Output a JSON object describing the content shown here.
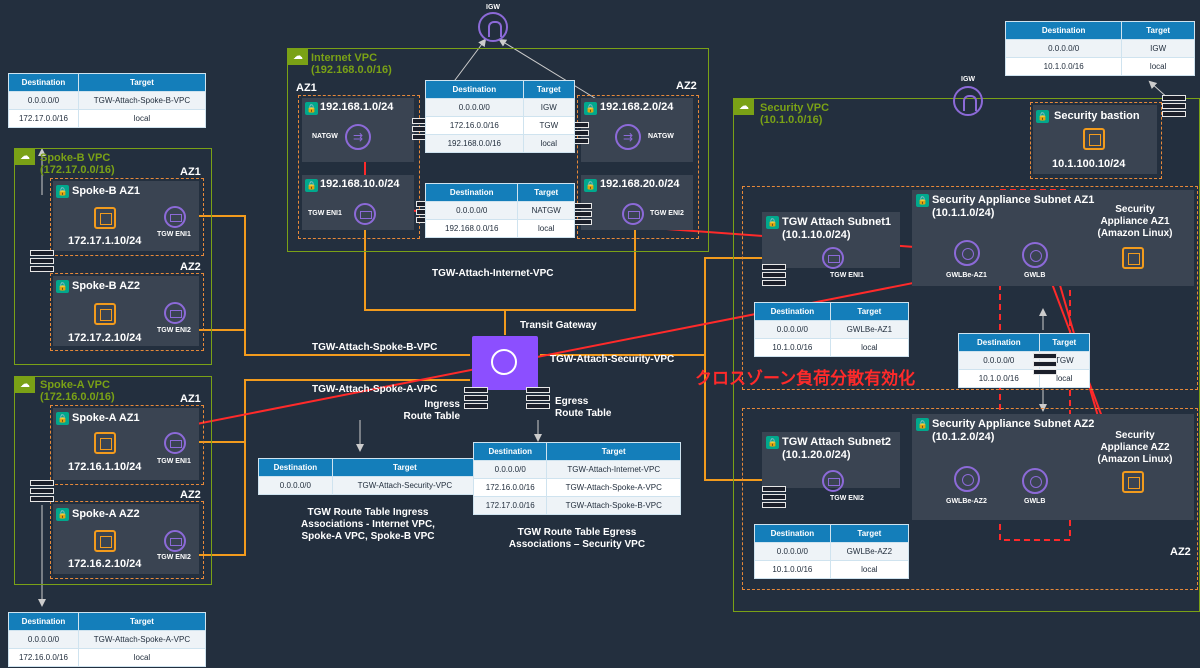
{
  "colors": {
    "vpc": "#7aa116",
    "az": "#e7893a",
    "line": "#f29b1d",
    "red": "#ff2a2a",
    "purple": "#8c6ad8",
    "table_header": "#147eba"
  },
  "headers": {
    "destination": "Destination",
    "target": "Target"
  },
  "igw_label": "IGW",
  "internet_vpc": {
    "title": "Internet VPC",
    "cidr": "(192.168.0.0/16)",
    "az1": "AZ1",
    "az2": "AZ2",
    "pub1": "192.168.1.0/24",
    "pub2": "192.168.2.0/24",
    "tgw1": "192.168.10.0/24",
    "tgw2": "192.168.20.0/24",
    "natgw": "NATGW",
    "eni1": "TGW ENI1",
    "eni2": "TGW ENI2",
    "public_rt": [
      [
        "0.0.0.0/0",
        "IGW"
      ],
      [
        "172.16.0.0/16",
        "TGW"
      ],
      [
        "192.168.0.0/16",
        "local"
      ]
    ],
    "private_rt": [
      [
        "0.0.0.0/0",
        "NATGW"
      ],
      [
        "192.168.0.0/16",
        "local"
      ]
    ],
    "attach": "TGW-Attach-Internet-VPC"
  },
  "spoke_b": {
    "rt": [
      [
        "0.0.0.0/0",
        "TGW-Attach-Spoke-B-VPC"
      ],
      [
        "172.17.0.0/16",
        "local"
      ]
    ],
    "title": "Spoke-B VPC",
    "cidr": "(172.17.0.0/16)",
    "az1": "AZ1",
    "az2": "AZ2",
    "sub1": "Spoke-B AZ1",
    "ip1": "172.17.1.10/24",
    "eni1": "TGW ENI1",
    "sub2": "Spoke-B AZ2",
    "ip2": "172.17.2.10/24",
    "eni2": "TGW ENI2",
    "attach": "TGW-Attach-Spoke-B-VPC"
  },
  "spoke_a": {
    "title": "Spoke-A VPC",
    "cidr": "(172.16.0.0/16)",
    "az1": "AZ1",
    "az2": "AZ2",
    "sub1": "Spoke-A AZ1",
    "ip1": "172.16.1.10/24",
    "eni1": "TGW ENI1",
    "sub2": "Spoke-A AZ2",
    "ip2": "172.16.2.10/24",
    "eni2": "TGW ENI2",
    "attach": "TGW-Attach-Spoke-A-VPC",
    "rt": [
      [
        "0.0.0.0/0",
        "TGW-Attach-Spoke-A-VPC"
      ],
      [
        "172.16.0.0/16",
        "local"
      ]
    ]
  },
  "tgw": {
    "label": "Transit Gateway",
    "ingress": "Ingress\nRoute Table",
    "egress": "Egress\nRoute Table",
    "ingress_rt": [
      [
        "0.0.0.0/0",
        "TGW-Attach-Security-VPC"
      ]
    ],
    "ingress_caption": "TGW Route Table Ingress\nAssociations - Internet VPC,\nSpoke-A VPC, Spoke-B VPC",
    "egress_rt": [
      [
        "0.0.0.0/0",
        "TGW-Attach-Internet-VPC"
      ],
      [
        "172.16.0.0/16",
        "TGW-Attach-Spoke-A-VPC"
      ],
      [
        "172.17.0.0/16",
        "TGW-Attach-Spoke-B-VPC"
      ]
    ],
    "egress_caption": "TGW Route Table Egress\nAssociations – Security VPC"
  },
  "security_vpc": {
    "title": "Security VPC",
    "cidr": "(10.1.0.0/16)",
    "top_rt": [
      [
        "0.0.0.0/0",
        "IGW"
      ],
      [
        "10.1.0.0/16",
        "local"
      ]
    ],
    "bastion": "Security bastion",
    "bastion_ip": "10.1.100.10/24",
    "attach": "TGW-Attach-Security-VPC",
    "tgw_sub1": "TGW Attach Subnet1\n(10.1.10.0/24)",
    "tgw_sub2": "TGW Attach Subnet2\n(10.1.20.0/24)",
    "eni1": "TGW ENI1",
    "eni2": "TGW ENI2",
    "rt1": [
      [
        "0.0.0.0/0",
        "GWLBe-AZ1"
      ],
      [
        "10.1.0.0/16",
        "local"
      ]
    ],
    "rt2": [
      [
        "0.0.0.0/0",
        "GWLBe-AZ2"
      ],
      [
        "10.1.0.0/16",
        "local"
      ]
    ],
    "app_sub1": "Security Appliance Subnet AZ1\n(10.1.1.0/24)",
    "app_sub2": "Security Appliance Subnet AZ2\n(10.1.2.0/24)",
    "gwlbe1": "GWLBe-AZ1",
    "gwlbe2": "GWLBe-AZ2",
    "gwlb": "GWLB",
    "mid_rt": [
      [
        "0.0.0.0/0",
        "TGW"
      ],
      [
        "10.1.0.0/16",
        "local"
      ]
    ],
    "app1": "Security\nAppliance AZ1\n(Amazon Linux)",
    "app2": "Security\nAppliance AZ2\n(Amazon Linux)",
    "az2": "AZ2"
  },
  "annotation": "クロスゾーン負荷分散有効化"
}
